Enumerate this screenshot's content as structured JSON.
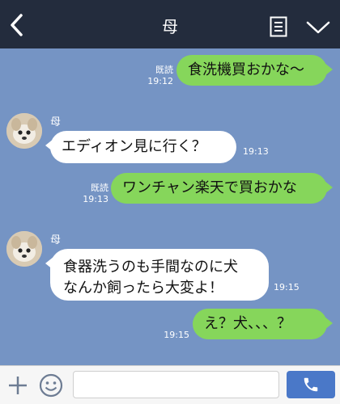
{
  "header": {
    "title": "母",
    "back_icon": "chevron-left-icon",
    "menu_icon": "note-icon",
    "dropdown_icon": "chevron-down-icon"
  },
  "messages": [
    {
      "direction": "out",
      "text": "食洗機買おかな〜",
      "read_label": "既読",
      "time": "19:12"
    },
    {
      "direction": "in",
      "sender": "母",
      "text": "エディオン見に行く？",
      "time": "19:13"
    },
    {
      "direction": "out",
      "text": "ワンチャン楽天で買おかな",
      "read_label": "既読",
      "time": "19:13"
    },
    {
      "direction": "in",
      "sender": "母",
      "line1": "食器洗うのも手間なのに犬",
      "line2": "なんか飼ったら大変よ！",
      "time": "19:15"
    },
    {
      "direction": "out",
      "text": "え？犬、、、？",
      "time": "19:15"
    }
  ],
  "input_bar": {
    "plus_icon": "plus-icon",
    "emoji_icon": "emoji-icon",
    "placeholder": "",
    "call_icon": "phone-icon"
  },
  "colors": {
    "header_bg": "#232c3d",
    "chat_bg": "#7594c4",
    "outgoing_bubble": "#86d65b",
    "incoming_bubble": "#ffffff",
    "call_button": "#4a78c8"
  }
}
